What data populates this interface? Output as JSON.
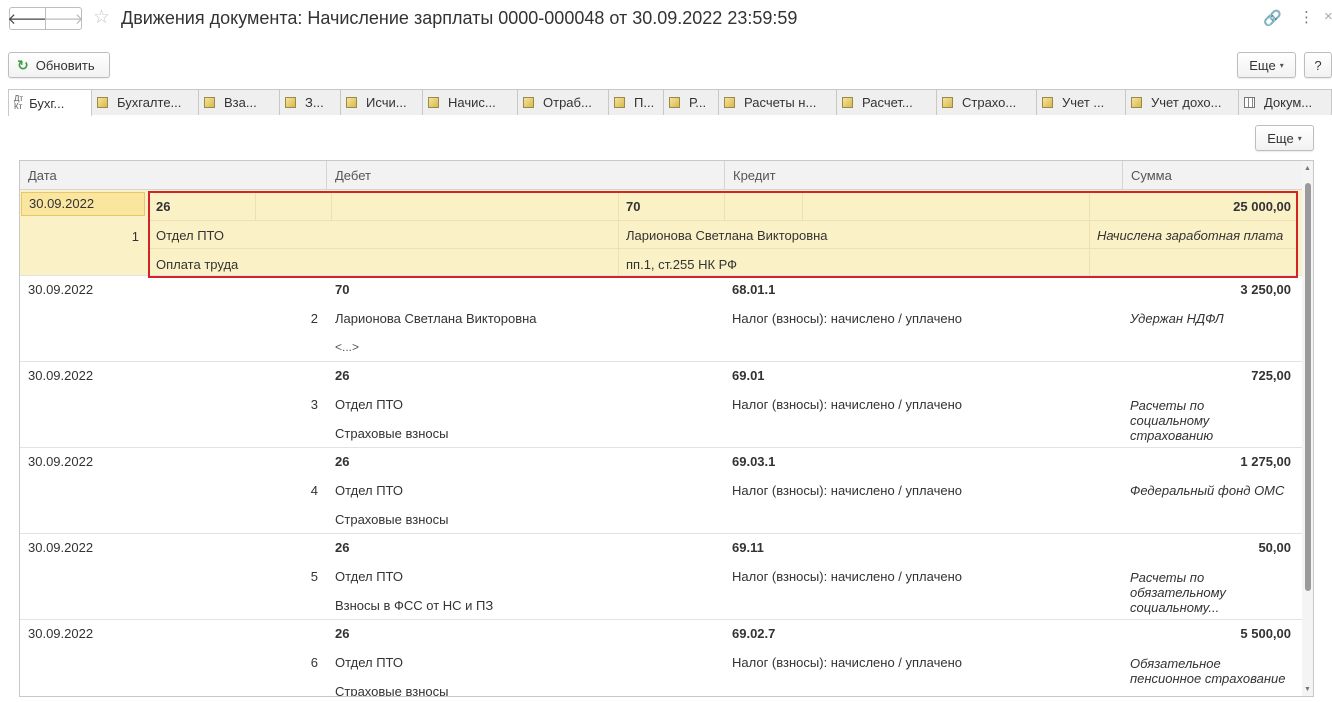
{
  "window": {
    "title": "Движения документа: Начисление зарплаты 0000-000048 от 30.09.2022 23:59:59",
    "back_glyph": "🡐",
    "forward_glyph": "🡒",
    "star_glyph": "☆",
    "link_glyph": "🔗",
    "menu_glyph": "⋮",
    "close_glyph": "×"
  },
  "toolbar": {
    "refresh_label": "Обновить",
    "refresh_glyph": "↻",
    "more_label": "Еще",
    "help_label": "?",
    "caret": "▾"
  },
  "tabs": [
    {
      "label": "Бухг...",
      "icon": "accounting-icon",
      "icon_text": "Дт\nКт",
      "active": true
    },
    {
      "label": "Бухгалте...",
      "icon": "register-icon"
    },
    {
      "label": "Вза...",
      "icon": "register-icon"
    },
    {
      "label": "З...",
      "icon": "register-icon"
    },
    {
      "label": "Исчи...",
      "icon": "register-icon"
    },
    {
      "label": "Начис...",
      "icon": "register-icon"
    },
    {
      "label": "Отраб...",
      "icon": "register-icon"
    },
    {
      "label": "П...",
      "icon": "register-icon"
    },
    {
      "label": "Р...",
      "icon": "register-icon"
    },
    {
      "label": "Расчеты н...",
      "icon": "register-icon"
    },
    {
      "label": "Расчет...",
      "icon": "register-icon"
    },
    {
      "label": "Страхо...",
      "icon": "register-icon"
    },
    {
      "label": "Учет ...",
      "icon": "register-icon"
    },
    {
      "label": "Учет дохо...",
      "icon": "register-icon"
    },
    {
      "label": "Докум...",
      "icon": "table-icon"
    }
  ],
  "table": {
    "more_label": "Еще",
    "columns": {
      "date": "Дата",
      "debit": "Дебет",
      "credit": "Кредит",
      "sum": "Сумма"
    },
    "rows": [
      {
        "date": "30.09.2022",
        "num": "1",
        "debit": "26",
        "debit_sub1": "Отдел ПТО",
        "debit_sub2": "Оплата труда",
        "credit": "70",
        "credit_sub1": "Ларионова Светлана Викторовна",
        "credit_sub2": "пп.1, ст.255 НК РФ",
        "sum": "25 000,00",
        "content": "Начислена заработная плата"
      },
      {
        "date": "30.09.2022",
        "num": "2",
        "debit": "70",
        "debit_sub1": "Ларионова Светлана Викторовна",
        "debit_sub2": "<...>",
        "credit": "68.01.1",
        "credit_sub1": "Налог (взносы): начислено / уплачено",
        "credit_sub2": "",
        "sum": "3 250,00",
        "content": "Удержан НДФЛ"
      },
      {
        "date": "30.09.2022",
        "num": "3",
        "debit": "26",
        "debit_sub1": "Отдел ПТО",
        "debit_sub2": "Страховые взносы",
        "credit": "69.01",
        "credit_sub1": "Налог (взносы): начислено / уплачено",
        "credit_sub2": "",
        "sum": "725,00",
        "content": "Расчеты по социальному страхованию"
      },
      {
        "date": "30.09.2022",
        "num": "4",
        "debit": "26",
        "debit_sub1": "Отдел ПТО",
        "debit_sub2": "Страховые взносы",
        "credit": "69.03.1",
        "credit_sub1": "Налог (взносы): начислено / уплачено",
        "credit_sub2": "",
        "sum": "1 275,00",
        "content": "Федеральный фонд ОМС"
      },
      {
        "date": "30.09.2022",
        "num": "5",
        "debit": "26",
        "debit_sub1": "Отдел ПТО",
        "debit_sub2": "Взносы в ФСС от НС и ПЗ",
        "credit": "69.11",
        "credit_sub1": "Налог (взносы): начислено / уплачено",
        "credit_sub2": "",
        "sum": "50,00",
        "content": "Расчеты по обязательному социальному..."
      },
      {
        "date": "30.09.2022",
        "num": "6",
        "debit": "26",
        "debit_sub1": "Отдел ПТО",
        "debit_sub2": "Страховые взносы",
        "credit": "69.02.7",
        "credit_sub1": "Налог (взносы): начислено / уплачено",
        "credit_sub2": "",
        "sum": "5 500,00",
        "content": "Обязательное пенсионное страхование"
      }
    ]
  },
  "colors": {
    "accent_selection": "#fbf1c6",
    "highlight_frame": "#d2232a",
    "refresh_icon": "#3a9d3a"
  }
}
